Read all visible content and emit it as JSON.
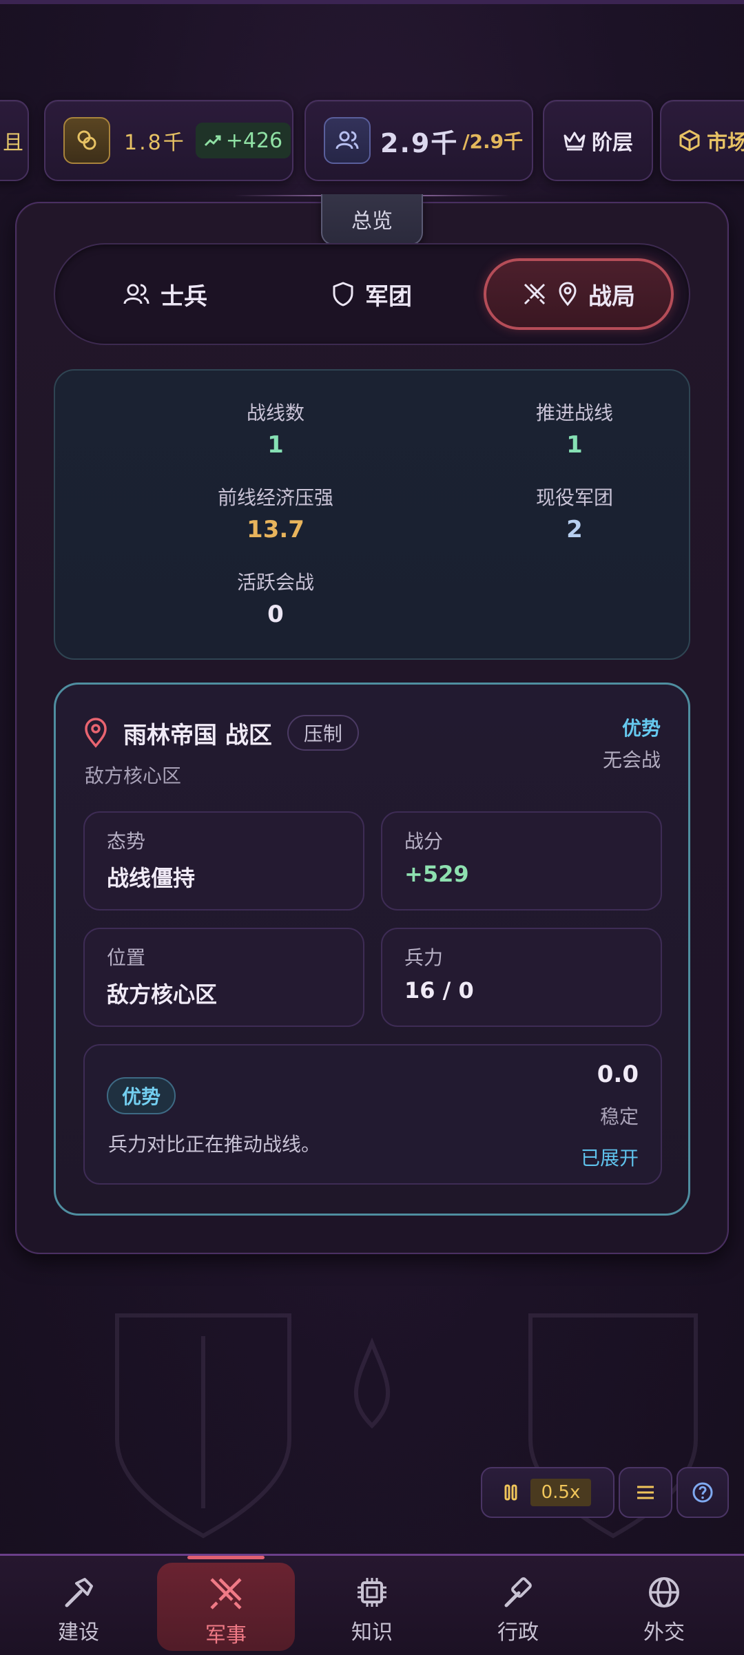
{
  "resources": {
    "gold_value": "1.8千",
    "gold_trend": "+426",
    "population_value": "2.9千",
    "population_max": "/2.9千",
    "strata_label": "阶层",
    "market_label": "市场"
  },
  "panel": {
    "tab_label": "总览",
    "segments": [
      "士兵",
      "军团",
      "战局"
    ],
    "active_segment": "战局"
  },
  "stats": [
    {
      "label": "战线数",
      "value": "1"
    },
    {
      "label": "推进战线",
      "value": "1"
    },
    {
      "label": "前线经济压强",
      "value": "13.7"
    },
    {
      "label": "现役军团",
      "value": "2"
    },
    {
      "label": "活跃会战",
      "value": "0"
    }
  ],
  "front": {
    "name": "雨林帝国 战区",
    "badge": "压制",
    "subtitle": "敌方核心区",
    "status_primary": "优势",
    "status_secondary": "无会战",
    "cells": [
      {
        "key": "态势",
        "value": "战线僵持"
      },
      {
        "key": "战分",
        "value": "+529"
      },
      {
        "key": "位置",
        "value": "敌方核心区"
      },
      {
        "key": "兵力",
        "value": "16 / 0"
      }
    ],
    "summary": {
      "pill": "优势",
      "text": "兵力对比正在推动战线。",
      "number": "0.0",
      "stability": "稳定",
      "expand": "已展开"
    }
  },
  "controls": {
    "speed": "0.5x"
  },
  "nav": [
    {
      "label": "建设",
      "icon": "hammer-icon"
    },
    {
      "label": "军事",
      "icon": "crossed-swords-icon"
    },
    {
      "label": "知识",
      "icon": "chip-icon"
    },
    {
      "label": "行政",
      "icon": "gavel-icon"
    },
    {
      "label": "外交",
      "icon": "globe-icon"
    }
  ],
  "colors": {
    "accent_red": "#b54d58",
    "accent_teal": "#4f8ea0",
    "gold": "#e7c264",
    "green": "#86e0b4"
  }
}
